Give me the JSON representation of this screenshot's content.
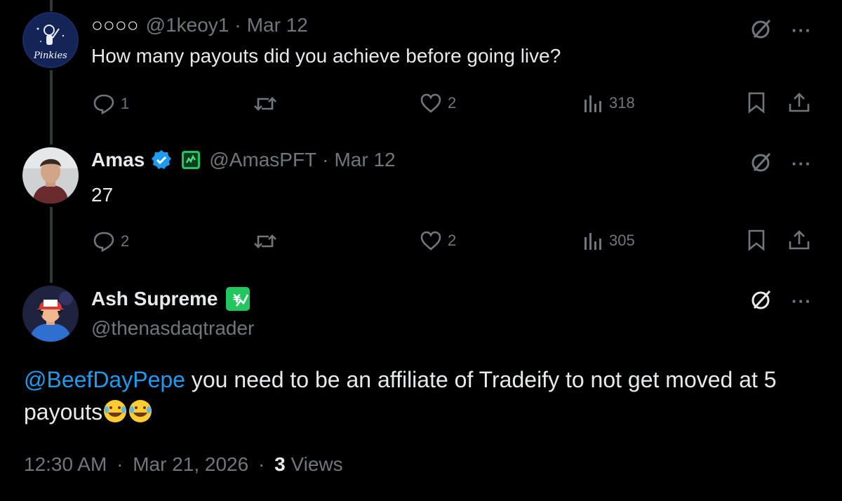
{
  "colors": {
    "background": "#000000",
    "text": "#e7e9ea",
    "muted": "#71767b",
    "link": "#1d9bf0",
    "verified": "#1d9bf0"
  },
  "reply1": {
    "name": "○○○○",
    "handle": "@1keoy1",
    "separator": "·",
    "date": "Mar 12",
    "text": "How many payouts did you achieve before going live?",
    "reply_count": "1",
    "like_count": "2",
    "view_count": "318",
    "avatar_text": "Pinkies"
  },
  "reply2": {
    "name": "Amas",
    "handle": "@AmasPFT",
    "separator": "·",
    "date": "Mar 12",
    "text": "27",
    "reply_count": "2",
    "like_count": "2",
    "view_count": "305"
  },
  "main_tweet": {
    "name": "Ash Supreme",
    "handle": "@thenasdaqtrader",
    "mention": "@BeefDayPepe",
    "text_after_mention": " you need to be an affiliate of Tradeify to not get moved at 5 payouts",
    "time": "12:30 AM",
    "separator": "·",
    "date": "Mar 21, 2026",
    "views_count": "3",
    "views_label": "Views"
  },
  "icons": [
    "grok-icon",
    "more-icon",
    "reply-icon",
    "retweet-icon",
    "like-icon",
    "views-icon",
    "bookmark-icon",
    "share-icon",
    "verified-icon"
  ]
}
